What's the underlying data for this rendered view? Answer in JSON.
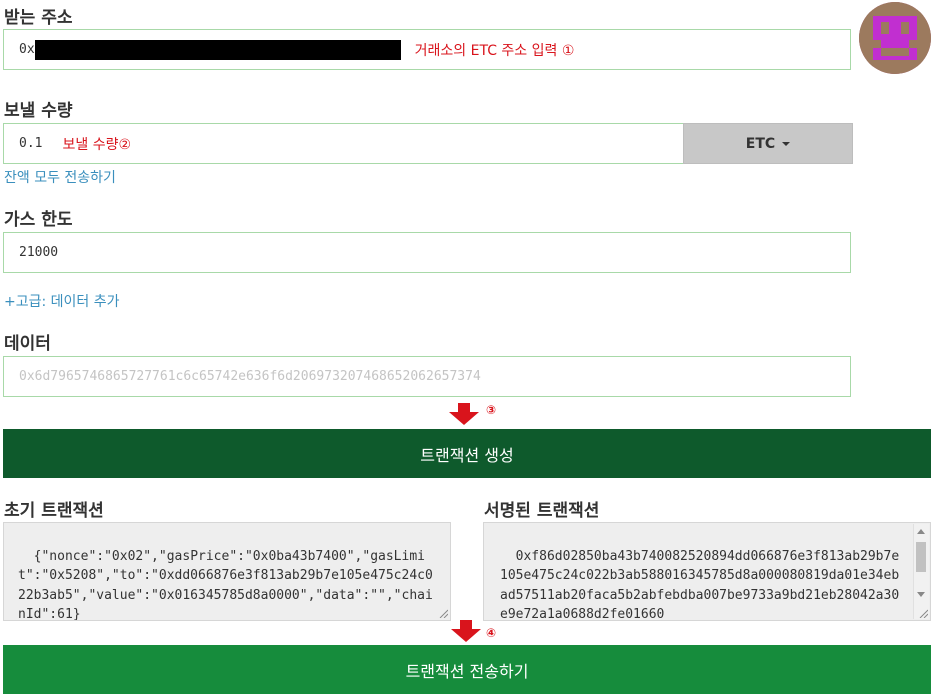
{
  "recipient": {
    "label": "받는 주소",
    "value_prefix": "0x",
    "annotation": "거래소의 ETC 주소 입력 ①"
  },
  "amount": {
    "label": "보낼 수량",
    "value": "0.1",
    "annotation": "보낼 수량②",
    "unit": "ETC",
    "send_all_link": "잔액 모두 전송하기"
  },
  "gas": {
    "label": "가스 한도",
    "value": "21000",
    "advanced_link": "+고급: 데이터 추가"
  },
  "data_field": {
    "label": "데이터",
    "placeholder": "0x6d7965746865727761c6c65742e636f6d206973207468652062657374"
  },
  "step3": "③",
  "generate_button": "트랜잭션 생성",
  "raw_tx": {
    "label": "초기 트랜잭션",
    "value": "{\"nonce\":\"0x02\",\"gasPrice\":\"0x0ba43b7400\",\"gasLimit\":\"0x5208\",\"to\":\"0xdd066876e3f813ab29b7e105e475c24c022b3ab5\",\"value\":\"0x016345785d8a0000\",\"data\":\"\",\"chainId\":61}"
  },
  "signed_tx": {
    "label": "서명된 트랜잭션",
    "value": "0xf86d02850ba43b740082520894dd066876e3f813ab29b7e105e475c24c022b3ab588016345785d8a000080819da01e34ebad57511ab20faca5b2abfebdba007be9733a9bd21eb28042a30e9e72a1a0688d2fe01660"
  },
  "step4": "④",
  "send_button": "트랜잭션 전송하기",
  "colors": {
    "generate_bg": "#0e5a2c",
    "send_bg": "#168c3c",
    "annotation_red": "#d9141c",
    "link_blue": "#3a8fbd",
    "field_border": "#a8d9a8"
  },
  "icons": {
    "identicon": "identicon-avatar",
    "arrow": "red-down-arrow-icon",
    "caret": "caret-down-icon"
  }
}
